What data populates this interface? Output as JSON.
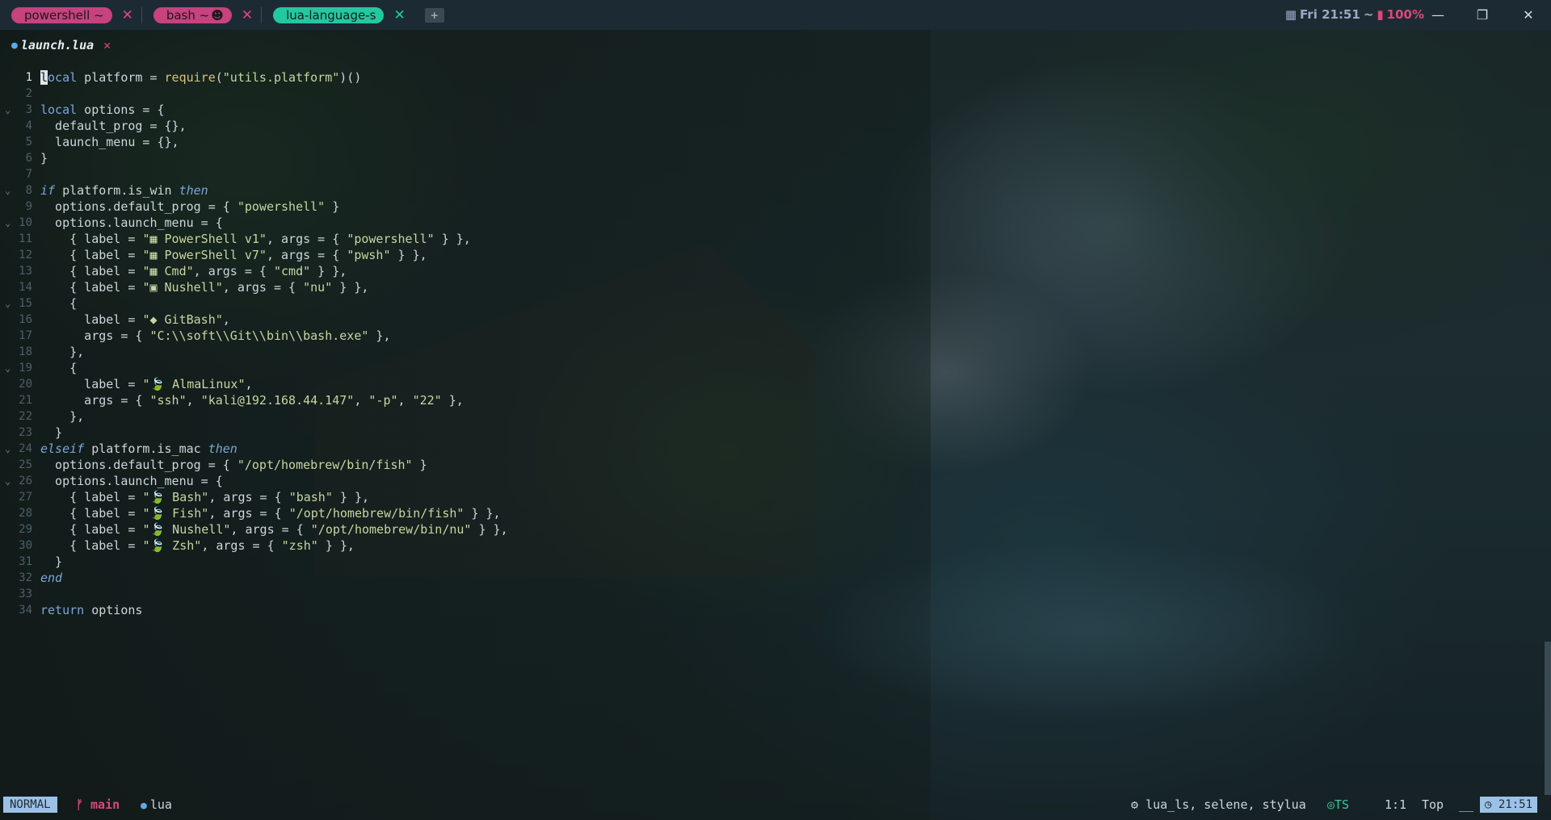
{
  "tabs": [
    {
      "label": "powershell ~",
      "color": "#e0467a",
      "active": false
    },
    {
      "label": "bash ~ ",
      "color": "#e0467a",
      "active": false
    },
    {
      "label": "lua-language-s",
      "color": "#24c8a0",
      "active": true
    }
  ],
  "new_tab_label": "+",
  "tab_close_glyph": "✕",
  "top_status": {
    "date_time": "Fri 21:51",
    "sep": "~",
    "battery": "100%"
  },
  "window_buttons": {
    "minimize": "—",
    "maximize": "❐",
    "close": "✕"
  },
  "buffer": {
    "name": "launch.lua",
    "close": "✕"
  },
  "code_lines": [
    {
      "n": "1",
      "fold": "",
      "html": "<span class='cursor'>l</span><span class='kw'>ocal</span> platform = <span class='fn'>require</span>(<span class='str'>\"utils.platform\"</span>)()",
      "text": "local platform = require(\"utils.platform\")()"
    },
    {
      "n": "2",
      "fold": "",
      "text": ""
    },
    {
      "n": "3",
      "fold": "⌄",
      "text": "local options = {"
    },
    {
      "n": "4",
      "fold": "",
      "text": "  default_prog = {},"
    },
    {
      "n": "5",
      "fold": "",
      "text": "  launch_menu = {},"
    },
    {
      "n": "6",
      "fold": "",
      "text": "}"
    },
    {
      "n": "7",
      "fold": "",
      "text": ""
    },
    {
      "n": "8",
      "fold": "⌄",
      "text": "if platform.is_win then"
    },
    {
      "n": "9",
      "fold": "",
      "text": "  options.default_prog = { \"powershell\" }"
    },
    {
      "n": "10",
      "fold": "⌄",
      "text": "  options.launch_menu = {"
    },
    {
      "n": "11",
      "fold": "",
      "text": "    { label = \"▦ PowerShell v1\", args = { \"powershell\" } },"
    },
    {
      "n": "12",
      "fold": "",
      "text": "    { label = \"▦ PowerShell v7\", args = { \"pwsh\" } },"
    },
    {
      "n": "13",
      "fold": "",
      "text": "    { label = \"▦ Cmd\", args = { \"cmd\" } },"
    },
    {
      "n": "14",
      "fold": "",
      "text": "    { label = \"▣ Nushell\", args = { \"nu\" } },"
    },
    {
      "n": "15",
      "fold": "⌄",
      "text": "    {"
    },
    {
      "n": "16",
      "fold": "",
      "text": "      label = \"◆ GitBash\","
    },
    {
      "n": "17",
      "fold": "",
      "text": "      args = { \"C:\\\\soft\\\\Git\\\\bin\\\\bash.exe\" },"
    },
    {
      "n": "18",
      "fold": "",
      "text": "    },"
    },
    {
      "n": "19",
      "fold": "⌄",
      "text": "    {"
    },
    {
      "n": "20",
      "fold": "",
      "text": "      label = \"🍃 AlmaLinux\","
    },
    {
      "n": "21",
      "fold": "",
      "text": "      args = { \"ssh\", \"kali@192.168.44.147\", \"-p\", \"22\" },"
    },
    {
      "n": "22",
      "fold": "",
      "text": "    },"
    },
    {
      "n": "23",
      "fold": "",
      "text": "  }"
    },
    {
      "n": "24",
      "fold": "⌄",
      "text": "elseif platform.is_mac then"
    },
    {
      "n": "25",
      "fold": "",
      "text": "  options.default_prog = { \"/opt/homebrew/bin/fish\" }"
    },
    {
      "n": "26",
      "fold": "⌄",
      "text": "  options.launch_menu = {"
    },
    {
      "n": "27",
      "fold": "",
      "text": "    { label = \"🍃 Bash\", args = { \"bash\" } },"
    },
    {
      "n": "28",
      "fold": "",
      "text": "    { label = \"🍃 Fish\", args = { \"/opt/homebrew/bin/fish\" } },"
    },
    {
      "n": "29",
      "fold": "",
      "text": "    { label = \"🍃 Nushell\", args = { \"/opt/homebrew/bin/nu\" } },"
    },
    {
      "n": "30",
      "fold": "",
      "text": "    { label = \"🍃 Zsh\", args = { \"zsh\" } },"
    },
    {
      "n": "31",
      "fold": "",
      "text": "  }"
    },
    {
      "n": "32",
      "fold": "",
      "text": "end"
    },
    {
      "n": "33",
      "fold": "",
      "text": ""
    },
    {
      "n": "34",
      "fold": "",
      "text": "return options"
    }
  ],
  "statusline": {
    "mode": "NORMAL",
    "branch": "main",
    "filetype": "lua",
    "lsp": "lua_ls, selene, stylua",
    "ts": "TS",
    "position": "1:1",
    "scroll": "Top",
    "clock": "21:51"
  },
  "colors": {
    "accent_pink": "#e0467a",
    "accent_teal": "#24c8a0",
    "mode_bg": "#9cc1e6"
  }
}
